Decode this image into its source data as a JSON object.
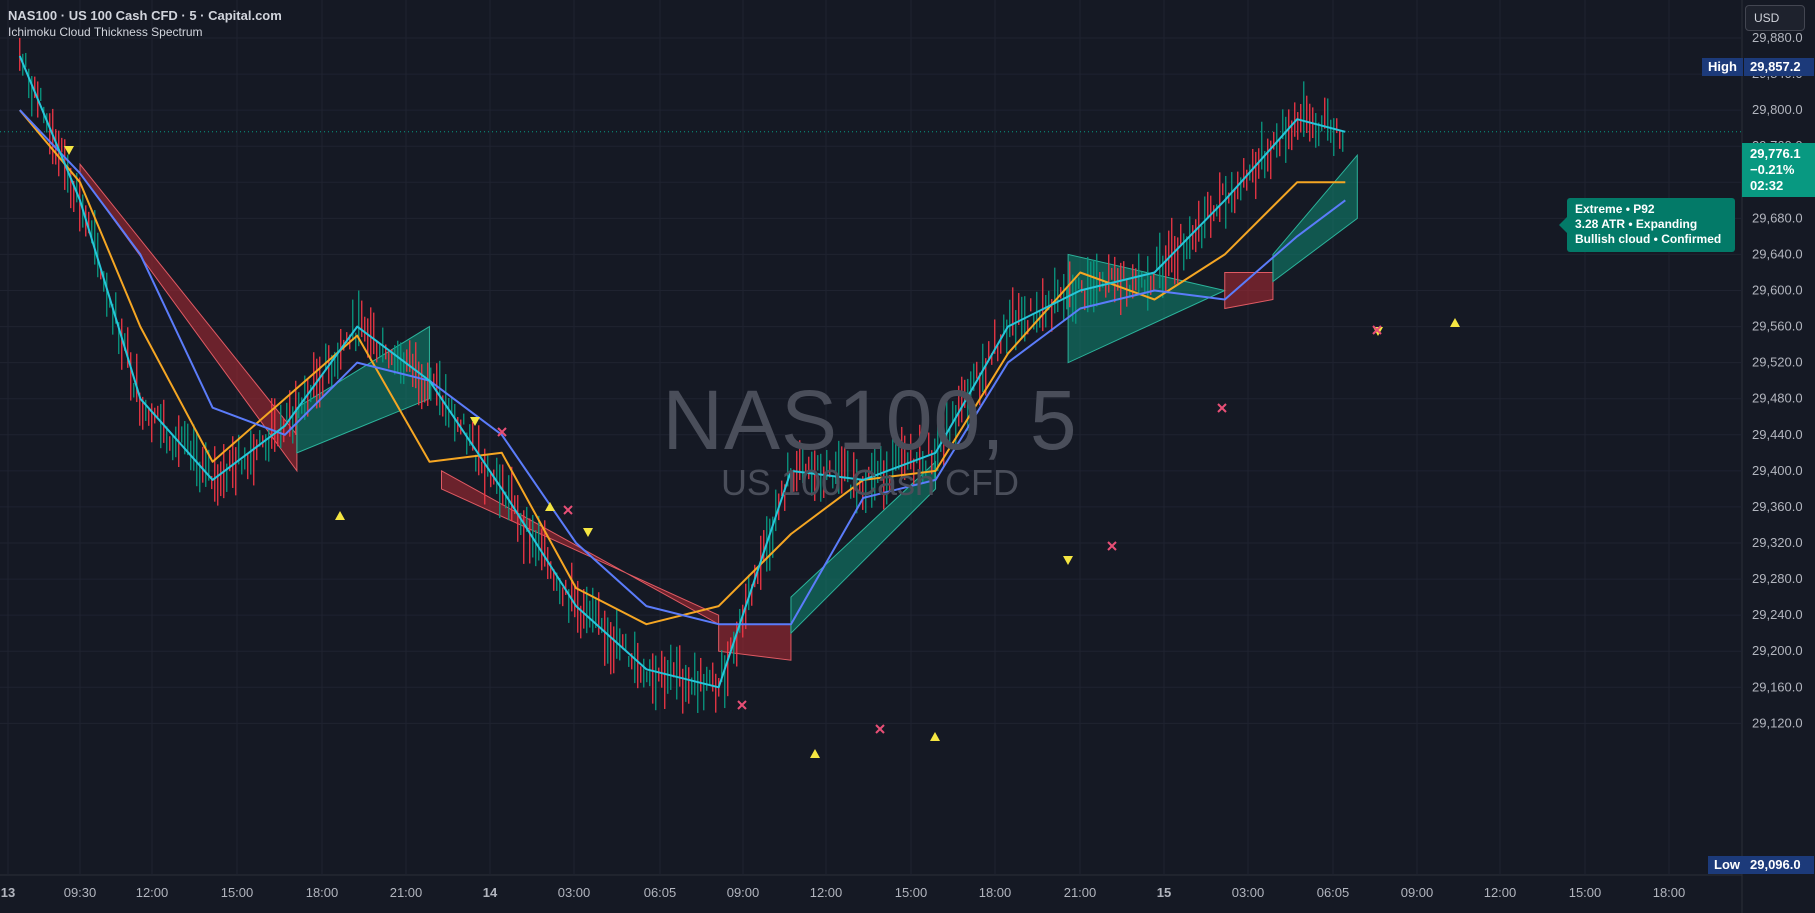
{
  "header": {
    "symbol_line": "NAS100 · US 100 Cash CFD · 5 · Capital.com",
    "indicator": "Ichimoku Cloud Thickness Spectrum"
  },
  "watermark": {
    "symbol": "NAS100, 5",
    "name": "US 100 Cash CFD"
  },
  "currency_button": "USD",
  "high_label": "High",
  "high_value": "29,857.2",
  "low_label": "Low",
  "low_value": "29,096.0",
  "last_price": {
    "price": "29,776.1",
    "change": "−0.21%",
    "countdown": "02:32"
  },
  "info_box": {
    "line1": "Extreme  •  P92",
    "line2": "3.28 ATR  •  Expanding",
    "line3": "Bullish cloud  •  Confirmed"
  },
  "colors": {
    "background": "#151924",
    "price_line": "#26c6da",
    "kijun": "#f5a623",
    "baseline": "#5b7cfa",
    "bull_cloud": "#0e8a72",
    "bear_cloud": "#b22a33",
    "up_bar": "#089981",
    "down_bar": "#f23645",
    "signal_up": "#f5e642",
    "cross": "#e84f76"
  },
  "chart_data": {
    "type": "line",
    "title": "NAS100 · US 100 Cash CFD · 5 · Capital.com",
    "yaxis_ticks": [
      "29,880.0",
      "29,840.0",
      "29,800.0",
      "29,760.0",
      "29,720.0",
      "29,680.0",
      "29,640.0",
      "29,600.0",
      "29,560.0",
      "29,520.0",
      "29,480.0",
      "29,440.0",
      "29,400.0",
      "29,360.0",
      "29,320.0",
      "29,280.0",
      "29,240.0",
      "29,200.0",
      "29,160.0",
      "29,120.0"
    ],
    "xaxis_ticks": [
      "13",
      "09:30",
      "12:00",
      "15:00",
      "18:00",
      "21:00",
      "14",
      "03:00",
      "06:05",
      "09:00",
      "12:00",
      "15:00",
      "18:00",
      "21:00",
      "15",
      "03:00",
      "06:05",
      "09:00",
      "12:00",
      "15:00",
      "18:00"
    ],
    "ylim": [
      29096,
      29880
    ],
    "x": [
      "13 07:00",
      "13 09:30",
      "13 12:00",
      "13 15:00",
      "13 18:00",
      "13 21:00",
      "14 00:00",
      "14 03:00",
      "14 06:05",
      "14 09:00",
      "14 12:00",
      "14 15:00",
      "14 18:00",
      "14 21:00",
      "15 00:00",
      "15 03:00",
      "15 06:05",
      "15 09:00",
      "15 12:00",
      "15 14:00"
    ],
    "series": [
      {
        "values": [
          29860,
          29700,
          29480,
          29390,
          29450,
          29560,
          29500,
          29380,
          29250,
          29180,
          29160,
          29400,
          29390,
          29420,
          29560,
          29600,
          29620,
          29700,
          29790,
          29776
        ]
      },
      {
        "values": [
          29800,
          29720,
          29560,
          29410,
          29480,
          29550,
          29410,
          29420,
          29270,
          29230,
          29250,
          29330,
          29390,
          29400,
          29530,
          29620,
          29590,
          29640,
          29720,
          29720
        ]
      },
      {
        "values": [
          29800,
          29730,
          29640,
          29470,
          29440,
          29520,
          29500,
          29440,
          29320,
          29250,
          29230,
          29230,
          29370,
          29390,
          29520,
          29580,
          29600,
          29590,
          29660,
          29700
        ]
      }
    ],
    "clouds": [
      {
        "x": [
          "13 09:30",
          "13 18:30"
        ],
        "top": [
          29740,
          29440
        ],
        "bottom": [
          29730,
          29400
        ],
        "trend": "bear"
      },
      {
        "x": [
          "13 18:30",
          "14 00:00"
        ],
        "top": [
          29470,
          29560
        ],
        "bottom": [
          29420,
          29480
        ],
        "trend": "bull"
      },
      {
        "x": [
          "14 00:30",
          "14 12:00"
        ],
        "top": [
          29400,
          29230
        ],
        "bottom": [
          29380,
          29240
        ],
        "trend": "bear"
      },
      {
        "x": [
          "14 12:00",
          "14 15:00"
        ],
        "top": [
          29230,
          29230
        ],
        "bottom": [
          29200,
          29190
        ],
        "trend": "bear"
      },
      {
        "x": [
          "14 15:00",
          "14 21:00"
        ],
        "top": [
          29260,
          29410
        ],
        "bottom": [
          29220,
          29380
        ],
        "trend": "bull"
      },
      {
        "x": [
          "15 02:30",
          "15 09:00"
        ],
        "top": [
          29640,
          29600
        ],
        "bottom": [
          29520,
          29600
        ],
        "trend": "bull"
      },
      {
        "x": [
          "15 09:00",
          "15 11:00"
        ],
        "top": [
          29620,
          29620
        ],
        "bottom": [
          29580,
          29590
        ],
        "trend": "bear"
      },
      {
        "x": [
          "15 11:00",
          "15 14:30"
        ],
        "top": [
          29640,
          29750
        ],
        "bottom": [
          29610,
          29680
        ],
        "trend": "bull"
      }
    ],
    "grid": true
  }
}
